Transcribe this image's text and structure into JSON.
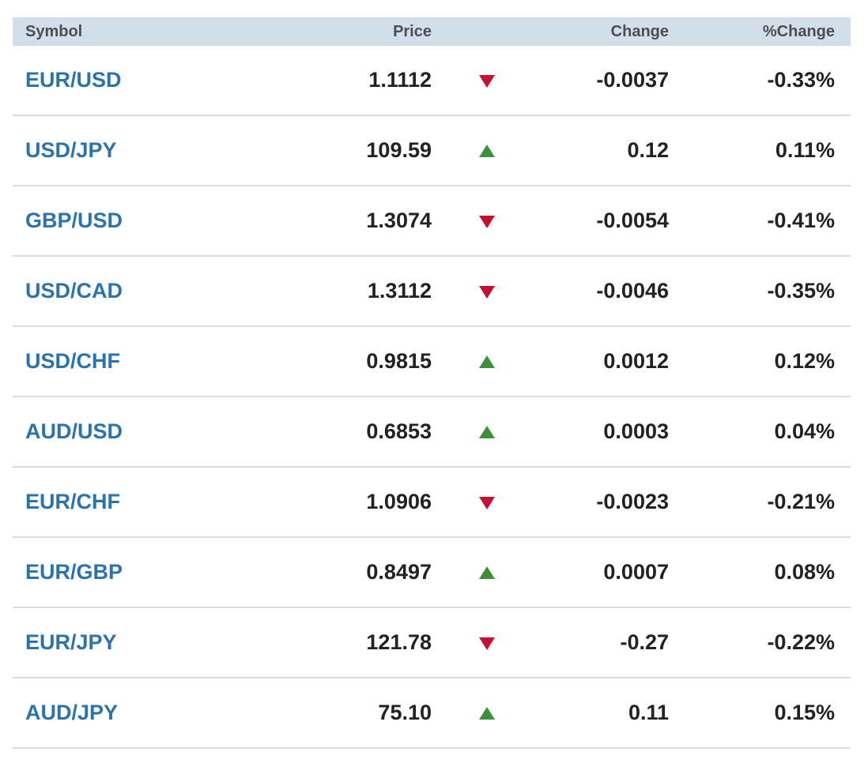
{
  "header": {
    "symbol": "Symbol",
    "price": "Price",
    "change": "Change",
    "pct_change": "%Change"
  },
  "colors": {
    "up": "#3f8f3a",
    "down": "#c8102e",
    "symbol_link": "#2b73ae",
    "header_bg": "#d3dfe8"
  },
  "rows": [
    {
      "symbol": "EUR/USD",
      "price": "1.1112",
      "direction": "down",
      "icon": "down-triangle-icon",
      "change": "-0.0037",
      "pct_change": "-0.33%"
    },
    {
      "symbol": "USD/JPY",
      "price": "109.59",
      "direction": "up",
      "icon": "up-triangle-icon",
      "change": "0.12",
      "pct_change": "0.11%"
    },
    {
      "symbol": "GBP/USD",
      "price": "1.3074",
      "direction": "down",
      "icon": "down-triangle-icon",
      "change": "-0.0054",
      "pct_change": "-0.41%"
    },
    {
      "symbol": "USD/CAD",
      "price": "1.3112",
      "direction": "down",
      "icon": "down-triangle-icon",
      "change": "-0.0046",
      "pct_change": "-0.35%"
    },
    {
      "symbol": "USD/CHF",
      "price": "0.9815",
      "direction": "up",
      "icon": "up-triangle-icon",
      "change": "0.0012",
      "pct_change": "0.12%"
    },
    {
      "symbol": "AUD/USD",
      "price": "0.6853",
      "direction": "up",
      "icon": "up-triangle-icon",
      "change": "0.0003",
      "pct_change": "0.04%"
    },
    {
      "symbol": "EUR/CHF",
      "price": "1.0906",
      "direction": "down",
      "icon": "down-triangle-icon",
      "change": "-0.0023",
      "pct_change": "-0.21%"
    },
    {
      "symbol": "EUR/GBP",
      "price": "0.8497",
      "direction": "up",
      "icon": "up-triangle-icon",
      "change": "0.0007",
      "pct_change": "0.08%"
    },
    {
      "symbol": "EUR/JPY",
      "price": "121.78",
      "direction": "down",
      "icon": "down-triangle-icon",
      "change": "-0.27",
      "pct_change": "-0.22%"
    },
    {
      "symbol": "AUD/JPY",
      "price": "75.10",
      "direction": "up",
      "icon": "up-triangle-icon",
      "change": "0.11",
      "pct_change": "0.15%"
    }
  ]
}
